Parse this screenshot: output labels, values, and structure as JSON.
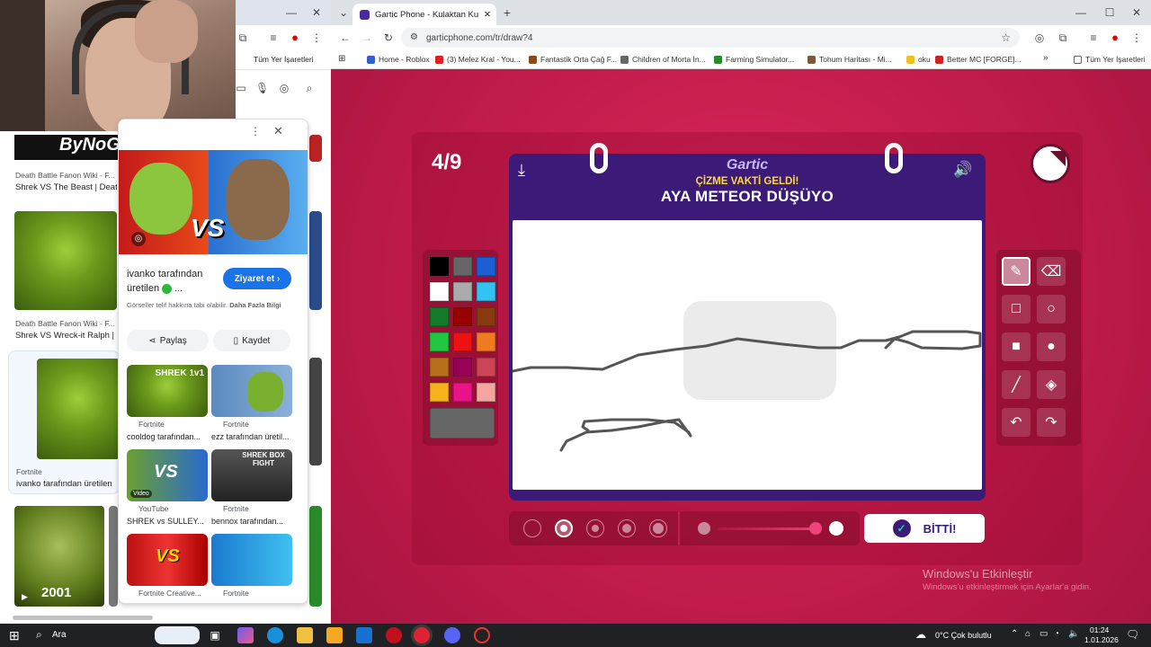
{
  "left_browser": {
    "search_result_items": [
      {
        "source": "Death Battle Fanon Wiki - F...",
        "title": "Shrek VS The Beast | Deat"
      },
      {
        "source": "Death Battle Fanon Wiki - F...",
        "title": "Shrek VS Wreck-it Ralph |"
      },
      {
        "source": "Fortnite",
        "title": "ivanko tarafından üretilen"
      }
    ],
    "year_badge": "2001",
    "channel_logo_text": "ByNoGame",
    "panel": {
      "author_line1": "ivanko tarafından",
      "author_line2": "üretilen",
      "visit_label": "Ziyaret et",
      "copyright_note": "Görseller telif hakkına tabi olabilir.",
      "more_info": "Daha Fazla Bilgi",
      "share_label": "Paylaş",
      "save_label": "Kaydet",
      "vs_text": "VS",
      "grid": [
        {
          "source": "Fortnite",
          "title": "cooldog tarafından...",
          "overlay": "SHREK 1v1"
        },
        {
          "source": "Fortnite",
          "title": "ezz tarafından üretil...",
          "overlay": ""
        },
        {
          "source": "YouTube",
          "title": "SHREK vs SULLEY...",
          "overlay": "VS",
          "badge": "Video"
        },
        {
          "source": "Fortnite",
          "title": "bennox tarafından...",
          "overlay": "SHREK BOX FIGHT"
        },
        {
          "source": "Fortnite Creative...",
          "title": "",
          "overlay": "VS"
        },
        {
          "source": "Fortnite",
          "title": "",
          "overlay": ""
        }
      ]
    }
  },
  "right_browser": {
    "tab_title": "Gartic Phone - Kulaktan Kulağa",
    "url": "garticphone.com/tr/draw?4",
    "bookmarks": [
      {
        "label": "Home - Roblox",
        "color": "#3060d0"
      },
      {
        "label": "(3) Melez Kral - You...",
        "color": "#e02020"
      },
      {
        "label": "Fantastik Orta Çağ F...",
        "color": "#8a4a1a"
      },
      {
        "label": "Children of Morta İn...",
        "color": "#666666"
      },
      {
        "label": "Farming Simulator...",
        "color": "#2a8a2a"
      },
      {
        "label": "Tohum Haritası - Mi...",
        "color": "#7a5a3a"
      },
      {
        "label": "oku",
        "color": "#f0c020"
      },
      {
        "label": "Better MC [FORGE]...",
        "color": "#d02020"
      }
    ],
    "all_bookmarks": "Tüm Yer İşaretleri"
  },
  "game": {
    "round": "4/9",
    "logo": "Gartic",
    "heading": "ÇİZME VAKTİ GELDİ!",
    "prompt": "AYA METEOR DÜŞÜYO",
    "done_label": "BİTTİ!",
    "palette": [
      "#000000",
      "#666666",
      "#1a5fd4",
      "#ffffff",
      "#aaaaaa",
      "#33c3f0",
      "#137a2a",
      "#990000",
      "#8a3a10",
      "#22c640",
      "#ee1111",
      "#f07a20",
      "#b86f1a",
      "#990055",
      "#cc4455",
      "#f5b21c",
      "#ea1388",
      "#f5a5a0"
    ],
    "tools": [
      "pencil",
      "eraser",
      "rect-outline",
      "circle-outline",
      "rect-fill",
      "circle-fill",
      "line",
      "fill-bucket",
      "undo",
      "redo"
    ],
    "watermark_title": "Windows'u Etkinleştir",
    "watermark_sub": "Windows'u etkinleştirmek için Ayarlar'a gidin."
  },
  "taskbar": {
    "search_label": "Ara",
    "weather": "0°C  Çok bulutlu",
    "time": "01:24",
    "date": "1.01.2026"
  }
}
